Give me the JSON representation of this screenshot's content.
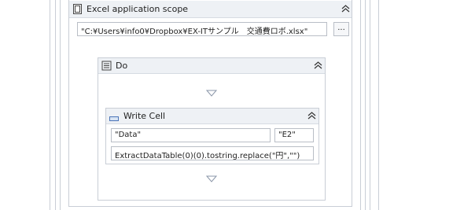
{
  "excel_scope": {
    "title": "Excel application scope",
    "workbook_path": "\"C:¥Users¥info0¥Dropbox¥EX-ITサンプル　交通費ロボ.xlsx\"",
    "browse_label": "...",
    "icon": "excel-scope-icon",
    "collapse_icon": "double-chevron-up-icon"
  },
  "do_sequence": {
    "title": "Do",
    "icon": "sequence-icon",
    "collapse_icon": "double-chevron-up-icon",
    "drop_indicator_icon": "drop-arrow-icon"
  },
  "write_cell": {
    "title": "Write Cell",
    "icon": "write-cell-icon",
    "collapse_icon": "double-chevron-up-icon",
    "sheet_name": "\"Data\"",
    "range": "\"E2\"",
    "value": "ExtractDataTable(0)(0).tostring.replace(\"円\",\"\")"
  },
  "colors": {
    "header_bg": "#eef1f5",
    "border": "#c9ced6",
    "input_border": "#b9bec6",
    "icon_blue": "#4a74b8"
  }
}
